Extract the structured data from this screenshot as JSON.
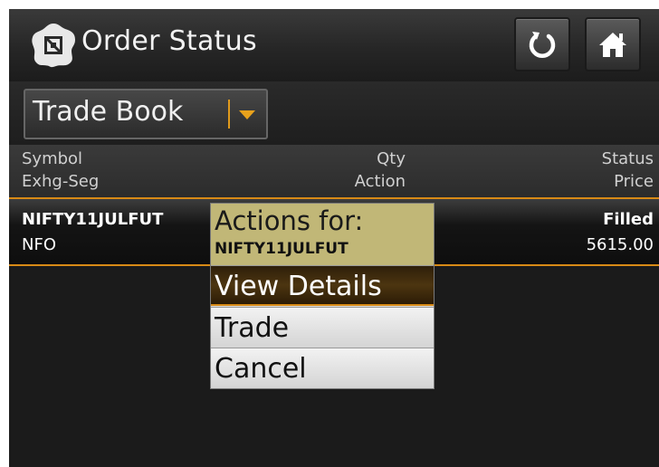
{
  "header": {
    "title": "Order Status",
    "refresh_icon": "refresh-icon",
    "home_icon": "home-icon"
  },
  "book_selector": {
    "selected": "Trade Book"
  },
  "columns": {
    "col1_line1": "Symbol",
    "col1_line2": "Exhg-Seg",
    "col2_line1": "Qty",
    "col2_line2": "Action",
    "col3_line1": "Status",
    "col3_line2": "Price"
  },
  "row": {
    "symbol": "NIFTY11JULFUT",
    "segment": "NFO",
    "status": "Filled",
    "price": "5615.00"
  },
  "context_menu": {
    "title": "Actions for:",
    "symbol": "NIFTY11JULFUT",
    "items": [
      "View Details",
      "Trade",
      "Cancel"
    ]
  },
  "colors": {
    "accent": "#d88a16",
    "menu_header": "#c1b777"
  }
}
